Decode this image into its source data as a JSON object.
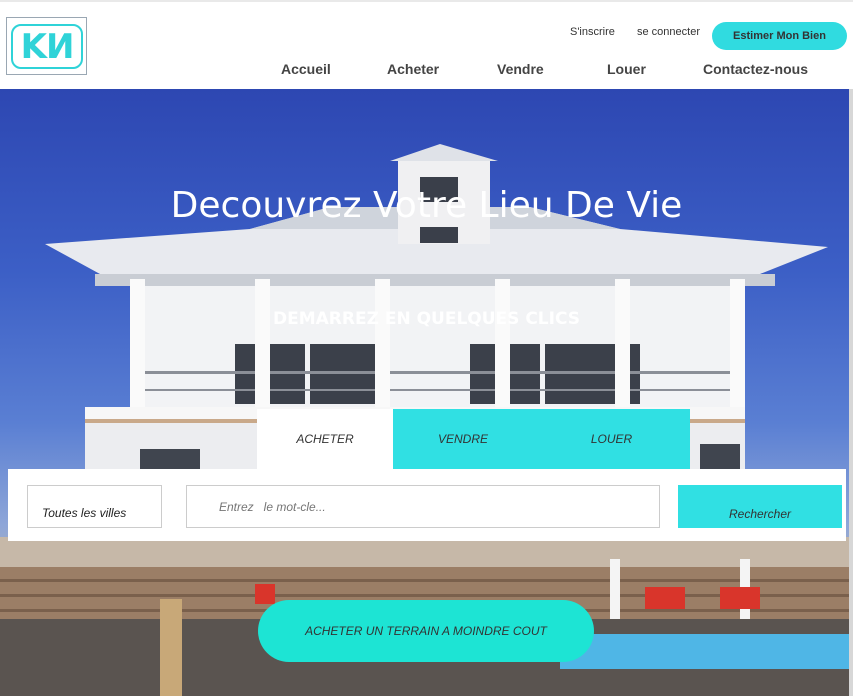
{
  "header": {
    "logo_text": "KИ",
    "signup": "S'inscrire",
    "login": "se connecter",
    "estimate_button": "Estimer  Mon Bien"
  },
  "nav": [
    "Accueil",
    "Acheter",
    "Vendre",
    "Louer",
    "Contactez-nous"
  ],
  "hero": {
    "title": "Decouvrez Votre Lieu De Vie",
    "subtitle": "DEMARREZ EN QUELQUES CLICS"
  },
  "tabs": [
    "ACHETER",
    "VENDRE",
    "LOUER"
  ],
  "search": {
    "city": "Toutes les villes",
    "keyword_placeholder": "Entrez   le mot-cle...",
    "button": "Rechercher"
  },
  "cta": "ACHETER UN TERRAIN A MOINDRE COUT",
  "colors": {
    "accent": "#30dbe0",
    "cta": "#1de4d4",
    "sky": "#3c5fc6"
  }
}
